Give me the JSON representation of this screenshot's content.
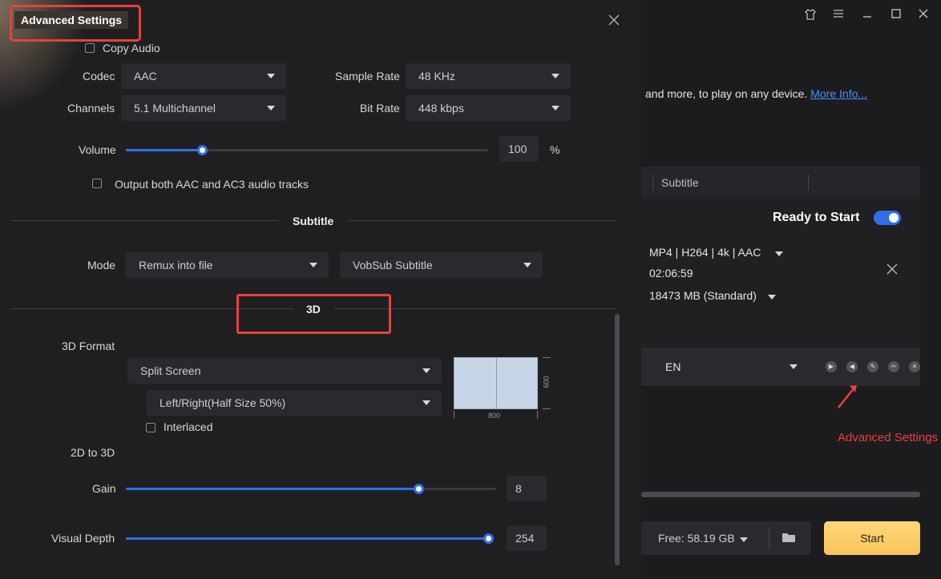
{
  "background": {
    "description_text": "and more, to play on any device.",
    "more_info_link": "More Info...",
    "list_header": {
      "subtitle_col": "Subtitle"
    },
    "status_label": "Ready to Start",
    "item": {
      "format": "MP4 | H264 | 4k | AAC",
      "duration": "02:06:59",
      "size": "18473 MB (Standard)",
      "subtitle_lang": "EN"
    },
    "free_space": "Free: 58.19 GB",
    "start_label": "Start",
    "annotation_label": "Advanced Settings"
  },
  "dialog": {
    "title": "Advanced Settings",
    "audio": {
      "copy_audio_label": "Copy Audio",
      "codec_label": "Codec",
      "codec_value": "AAC",
      "sample_rate_label": "Sample Rate",
      "sample_rate_value": "48 KHz",
      "channels_label": "Channels",
      "channels_value": "5.1 Multichannel",
      "bit_rate_label": "Bit Rate",
      "bit_rate_value": "448 kbps",
      "volume_label": "Volume",
      "volume_value": "100",
      "volume_unit": "%",
      "volume_level": 0.21,
      "dual_track_label": "Output both AAC and AC3 audio tracks"
    },
    "subtitle": {
      "section_title": "Subtitle",
      "mode_label": "Mode",
      "mode_value": "Remux into file",
      "type_value": "VobSub Subtitle"
    },
    "three_d": {
      "section_title": "3D",
      "format_label": "3D Format",
      "format_value": "Split Screen",
      "layout_value": "Left/Right(Half Size 50%)",
      "interlaced_label": "Interlaced",
      "preview_width": "800",
      "preview_height": "600",
      "two_d_to_three_d_label": "2D to 3D",
      "gain_label": "Gain",
      "gain_value": "8",
      "gain_level": 0.79,
      "depth_label": "Visual Depth",
      "depth_value": "254",
      "depth_level": 1.0
    }
  },
  "colors": {
    "accent": "#2f6fe8",
    "highlight": "#e8413a",
    "start": "#f8c55a"
  }
}
